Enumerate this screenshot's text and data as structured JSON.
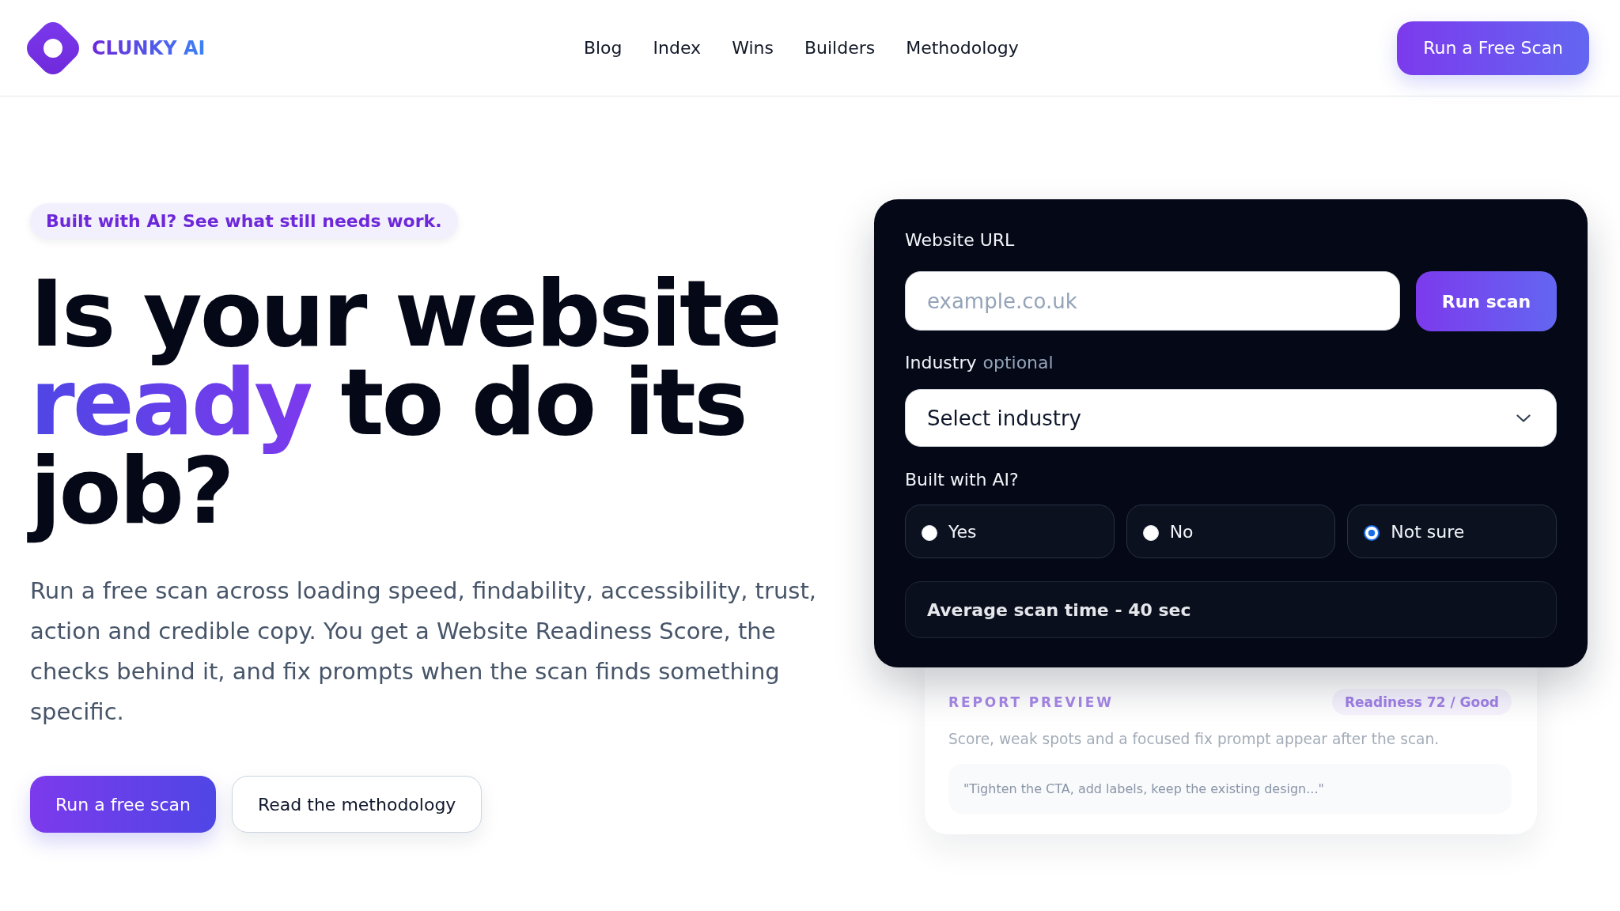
{
  "header": {
    "logo_text": "CLUNKY AI",
    "nav": [
      "Blog",
      "Index",
      "Wins",
      "Builders",
      "Methodology"
    ],
    "cta": "Run a Free Scan"
  },
  "hero": {
    "eyebrow": "Built with AI? See what still needs work.",
    "headline": [
      {
        "text": "Is your website ",
        "highlight": false
      },
      {
        "text": "ready",
        "highlight": true
      },
      {
        "text": " to do its job?",
        "highlight": false
      }
    ],
    "description": "Run a free scan across loading speed, findability, accessibility, trust, action and credible copy. You get a Website Readiness Score, the checks behind it, and fix prompts when the scan finds something specific.",
    "buttons": [
      {
        "label": "Run a free scan",
        "kind": "primary"
      },
      {
        "label": "Read the methodology",
        "kind": "secondary"
      }
    ]
  },
  "scan_form": {
    "url_field": {
      "label": "Website URL",
      "placeholder": "example.co.uk"
    },
    "submit": "Run scan",
    "industry": {
      "label": "Industry",
      "hint": "optional",
      "value": "Select industry"
    },
    "built_with_ai": {
      "label": "Built with AI?",
      "options": [
        {
          "label": "Yes",
          "selected": false
        },
        {
          "label": "No",
          "selected": false
        },
        {
          "label": "Not sure",
          "selected": true
        }
      ]
    },
    "scan_time": "Average scan time - 40 sec"
  },
  "report_preview": {
    "heading": "REPORT PREVIEW",
    "badge": "Readiness 72 / Good",
    "summary": "Score, weak spots and a focused fix prompt appear after the scan.",
    "prompt": "\"Tighten the CTA, add labels, keep the existing design...\""
  }
}
